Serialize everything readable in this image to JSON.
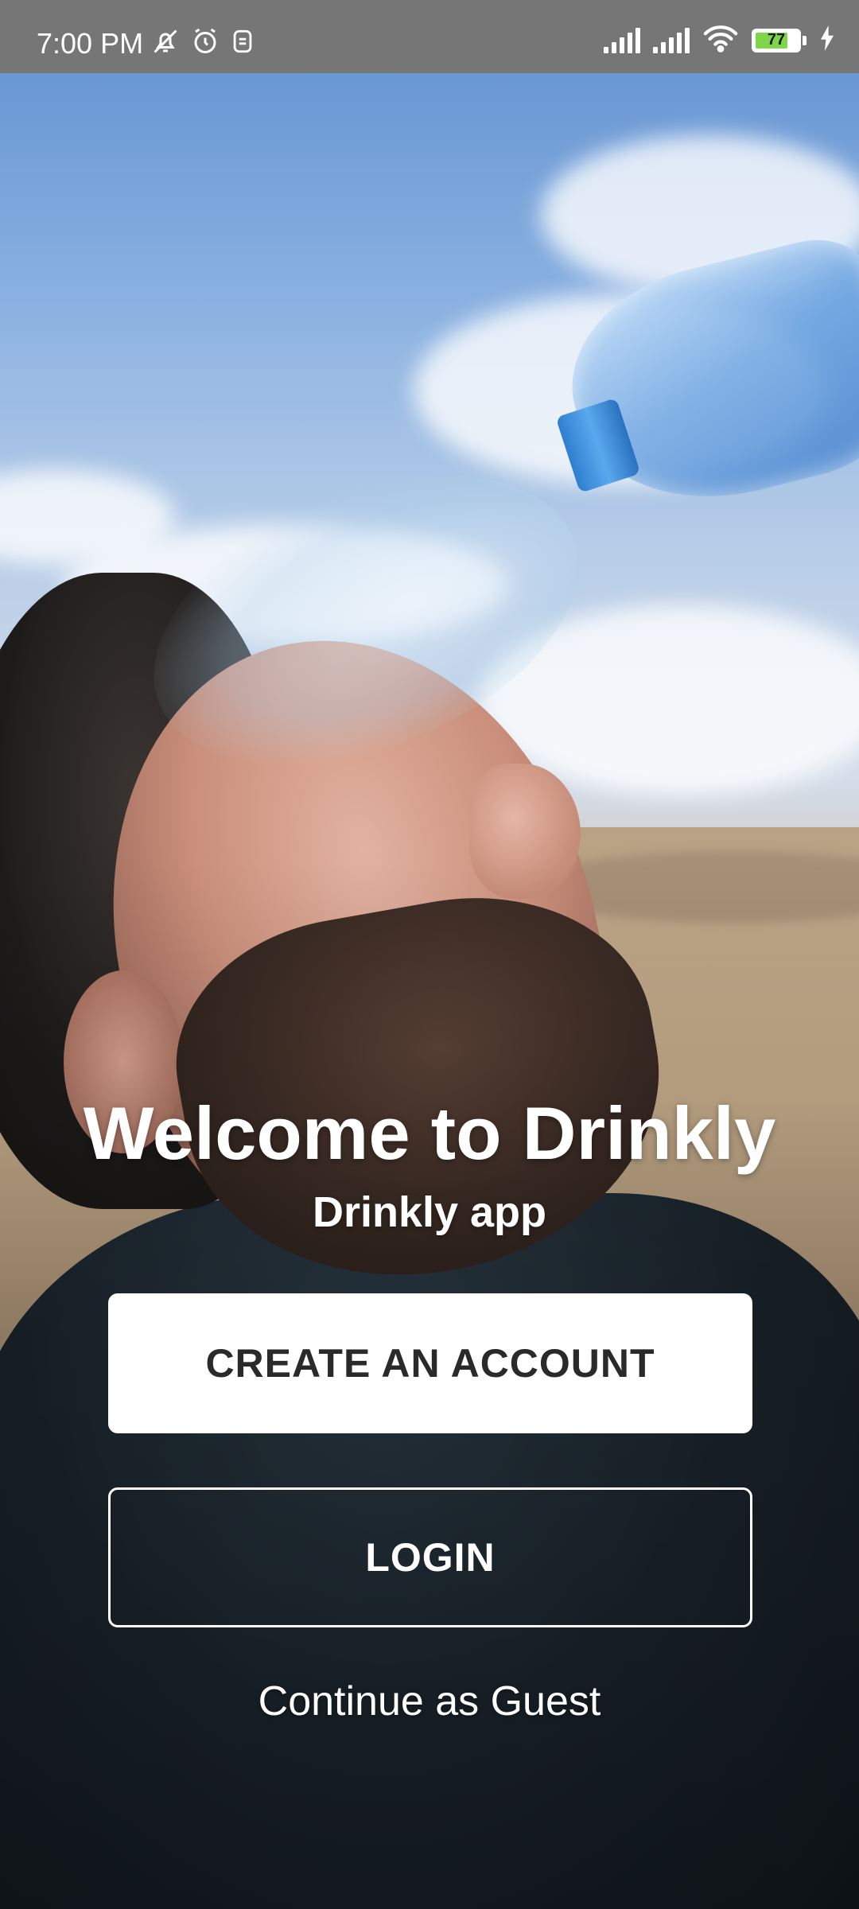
{
  "status_bar": {
    "time": "7:00 PM",
    "battery_level": "77",
    "battery_fraction": 0.77,
    "battery_color": "#7ed64a",
    "icons_left": [
      "mute-icon",
      "alarm-icon",
      "app-notification-icon"
    ],
    "icons_right": [
      "signal-icon",
      "signal-icon",
      "wifi-icon",
      "battery-icon",
      "charging-icon"
    ]
  },
  "welcome": {
    "title": "Welcome to Drinkly",
    "subtitle": "Drinkly app"
  },
  "buttons": {
    "create_account": "CREATE AN ACCOUNT",
    "login": "LOGIN",
    "guest": "Continue as Guest"
  },
  "colors": {
    "primary_button_bg": "#ffffff",
    "primary_button_text": "#2a2a2a",
    "outline": "#ffffff",
    "status_bar_bg": "#767676"
  }
}
